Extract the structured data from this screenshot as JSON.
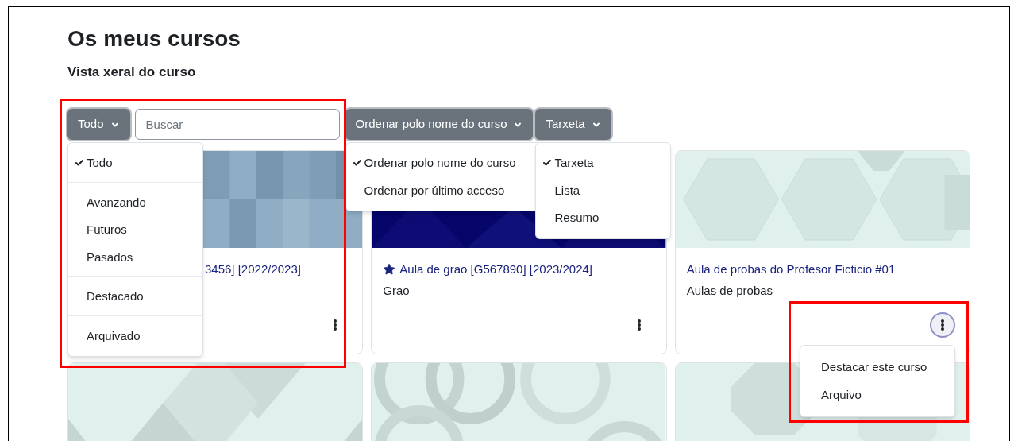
{
  "heading": "Os meus cursos",
  "subheading": "Vista xeral do curso",
  "filter": {
    "label": "Todo",
    "expanded": true,
    "highlighted": true,
    "groups": [
      {
        "items": [
          {
            "label": "Todo",
            "selected": true
          }
        ]
      },
      {
        "items": [
          {
            "label": "Avanzando",
            "selected": false
          },
          {
            "label": "Futuros",
            "selected": false
          },
          {
            "label": "Pasados",
            "selected": false
          }
        ]
      },
      {
        "items": [
          {
            "label": "Destacado",
            "selected": false
          }
        ]
      },
      {
        "items": [
          {
            "label": "Arquivado",
            "selected": false
          }
        ]
      }
    ]
  },
  "search": {
    "placeholder": "Buscar"
  },
  "sort": {
    "label": "Ordenar polo nome do curso",
    "expanded": true,
    "items": [
      {
        "label": "Ordenar polo nome do curso",
        "selected": true
      },
      {
        "label": "Ordenar por último acceso",
        "selected": false
      }
    ]
  },
  "view": {
    "label": "Tarxeta",
    "expanded": true,
    "items": [
      {
        "label": "Tarxeta",
        "selected": true
      },
      {
        "label": "Lista",
        "selected": false
      },
      {
        "label": "Resumo",
        "selected": false
      }
    ]
  },
  "cards": [
    {
      "image": {
        "kind": "picture"
      },
      "title": "3456] [2022/2023]",
      "favourite": false,
      "menu_open": false
    },
    {
      "image": {
        "kind": "picture"
      },
      "title": "Aula de grao [G567890] [2023/2024]",
      "category": "Grao",
      "favourite": true,
      "menu_open": false
    },
    {
      "image": {
        "kind": "picture"
      },
      "title": "Aula de probas do Profesor Ficticio #01",
      "category": "Aulas de probas",
      "favourite": false,
      "menu_open": true,
      "highlighted": true,
      "menu_items": [
        "Destacar este curso",
        "Arquivo"
      ]
    },
    {
      "image": {
        "kind": "picture"
      }
    },
    {
      "image": {
        "kind": "picture"
      }
    },
    {
      "image": {
        "kind": "picture"
      }
    }
  ]
}
